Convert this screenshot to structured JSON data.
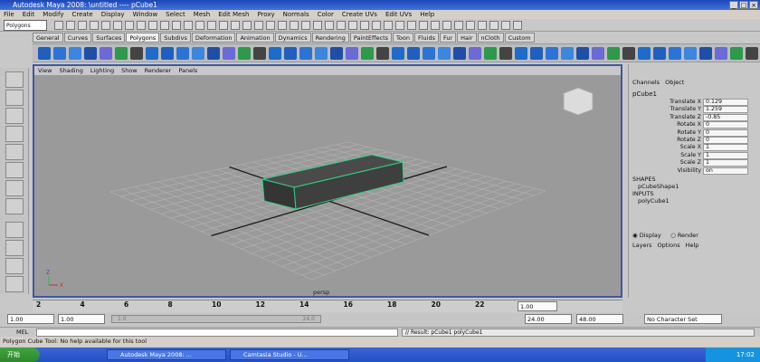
{
  "window": {
    "title": "Autodesk Maya 2008: \\untitled  ----  pCube1"
  },
  "menu": [
    "File",
    "Edit",
    "Modify",
    "Create",
    "Display",
    "Window",
    "Select",
    "Mesh",
    "Edit Mesh",
    "Proxy",
    "Normals",
    "Color",
    "Create UVs",
    "Edit UVs",
    "Help"
  ],
  "status_line": {
    "mode": "Polygons"
  },
  "shelf_tabs": [
    "General",
    "Curves",
    "Surfaces",
    "Polygons",
    "Subdivs",
    "Deformation",
    "Animation",
    "Dynamics",
    "Rendering",
    "PaintEffects",
    "Toon",
    "Fluids",
    "Fur",
    "Hair",
    "nCloth",
    "Custom"
  ],
  "shelf_active": "Polygons",
  "viewport": {
    "menu": [
      "View",
      "Shading",
      "Lighting",
      "Show",
      "Renderer",
      "Panels"
    ],
    "camera": "persp",
    "axis_labels": [
      "Z",
      "X"
    ]
  },
  "channel_box": {
    "tabs": [
      "Channels",
      "Object"
    ],
    "object": "pCube1",
    "attributes": [
      {
        "name": "Translate X",
        "value": "0.129"
      },
      {
        "name": "Translate Y",
        "value": "1.259"
      },
      {
        "name": "Translate Z",
        "value": "-0.85"
      },
      {
        "name": "Rotate X",
        "value": "0"
      },
      {
        "name": "Rotate Y",
        "value": "0"
      },
      {
        "name": "Rotate Z",
        "value": "0"
      },
      {
        "name": "Scale X",
        "value": "1"
      },
      {
        "name": "Scale Y",
        "value": "1"
      },
      {
        "name": "Scale Z",
        "value": "1"
      },
      {
        "name": "Visibility",
        "value": "on"
      }
    ],
    "shapes_label": "SHAPES",
    "shape_node": "pCubeShape1",
    "inputs_label": "INPUTS",
    "input_node": "polyCube1",
    "display_tab": "Display",
    "render_tab": "Render",
    "layer_menu": [
      "Layers",
      "Options",
      "Help"
    ]
  },
  "timeline": {
    "ticks": [
      "2",
      "4",
      "6",
      "8",
      "10",
      "12",
      "14",
      "16",
      "18",
      "20",
      "22",
      "24"
    ],
    "current_frame": "1.00"
  },
  "range": {
    "start": "1.00",
    "playback_start": "1.00",
    "slider_left": "1.0",
    "slider_right": "24.0",
    "playback_end": "24.00",
    "end": "48.00",
    "character_set": "No Character Set"
  },
  "command_line": {
    "label": "MEL",
    "result": "// Result: pCube1 polyCube1"
  },
  "help_line": "Polygon Cube Tool: No help available for this tool",
  "taskbar": {
    "start": "开始",
    "items": [
      "Autodesk Maya 2008: ...",
      "Camtasia Studio - U..."
    ],
    "clock": "17:02"
  },
  "colors": {
    "title": "#2a57d0",
    "viewport_bg": "#9a9a9a",
    "cube": "#3f3f3f",
    "selection": "#29d489"
  }
}
